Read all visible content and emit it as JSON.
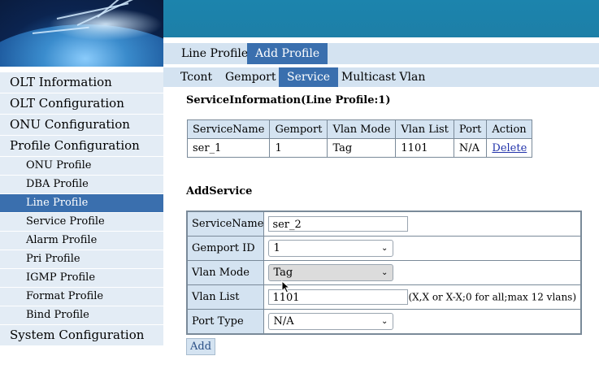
{
  "sidebar": {
    "items": [
      {
        "label": "OLT Information",
        "level": 0,
        "active": false
      },
      {
        "label": "OLT Configuration",
        "level": 0,
        "active": false
      },
      {
        "label": "ONU Configuration",
        "level": 0,
        "active": false
      },
      {
        "label": "Profile Configuration",
        "level": 0,
        "active": false
      },
      {
        "label": "ONU Profile",
        "level": 1,
        "active": false
      },
      {
        "label": "DBA Profile",
        "level": 1,
        "active": false
      },
      {
        "label": "Line Profile",
        "level": 1,
        "active": true
      },
      {
        "label": "Service Profile",
        "level": 1,
        "active": false
      },
      {
        "label": "Alarm Profile",
        "level": 1,
        "active": false
      },
      {
        "label": "Pri Profile",
        "level": 1,
        "active": false
      },
      {
        "label": "IGMP Profile",
        "level": 1,
        "active": false
      },
      {
        "label": "Format Profile",
        "level": 1,
        "active": false
      },
      {
        "label": "Bind Profile",
        "level": 1,
        "active": false
      },
      {
        "label": "System Configuration",
        "level": 0,
        "active": false
      }
    ]
  },
  "tabs_primary": [
    {
      "label": "Line Profile",
      "active": false
    },
    {
      "label": "Add Profile",
      "active": true
    }
  ],
  "tabs_secondary": [
    {
      "label": "Tcont",
      "active": false
    },
    {
      "label": "Gemport",
      "active": false
    },
    {
      "label": "Service",
      "active": true
    },
    {
      "label": "Multicast Vlan",
      "active": false
    }
  ],
  "service_info": {
    "title": "ServiceInformation(Line Profile:1)",
    "columns": [
      "ServiceName",
      "Gemport",
      "Vlan Mode",
      "Vlan List",
      "Port",
      "Action"
    ],
    "rows": [
      {
        "service_name": "ser_1",
        "gemport": "1",
        "vlan_mode": "Tag",
        "vlan_list": "1101",
        "port": "N/A",
        "action": "Delete"
      }
    ]
  },
  "add_service": {
    "title": "AddService",
    "fields": {
      "service_name": {
        "label": "ServiceName",
        "value": "ser_2"
      },
      "gemport_id": {
        "label": "Gemport ID",
        "value": "1"
      },
      "vlan_mode": {
        "label": "Vlan Mode",
        "value": "Tag"
      },
      "vlan_list": {
        "label": "Vlan List",
        "value": "1101",
        "hint": "(X,X or X-X;0 for all;max 12 vlans)"
      },
      "port_type": {
        "label": "Port Type",
        "value": "N/A"
      }
    },
    "add_button": "Add"
  },
  "colors": {
    "banner": "#1d7fa7",
    "sidebar_bg": "#e3ecf5",
    "active_blue": "#3a6fae",
    "table_header": "#d4e3f1"
  },
  "icons": [
    "chevron-down-icon",
    "mouse-cursor-icon",
    "globe-logo"
  ]
}
